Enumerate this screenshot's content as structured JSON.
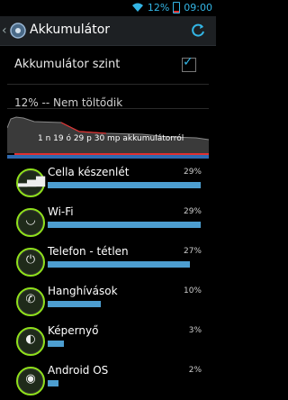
{
  "status_bar": {
    "battery_percent": "12%",
    "time": "09:00"
  },
  "action_bar": {
    "title": "Akkumulátor"
  },
  "settings": {
    "battery_level_label": "Akkumulátor szint",
    "battery_level_checked": true
  },
  "battery_status": "12% -- Nem töltődik",
  "graph": {
    "label": "1 n 19 ó 29 p 30 mp akkumulátorról"
  },
  "usage": [
    {
      "name": "Cella készenlét",
      "percent": "29%",
      "value": 29,
      "icon": "signal-bars-icon"
    },
    {
      "name": "Wi-Fi",
      "percent": "29%",
      "value": 29,
      "icon": "wifi-icon"
    },
    {
      "name": "Telefon - tétlen",
      "percent": "27%",
      "value": 27,
      "icon": "power-icon"
    },
    {
      "name": "Hanghívások",
      "percent": "10%",
      "value": 10,
      "icon": "phone-icon"
    },
    {
      "name": "Képernyő",
      "percent": "3%",
      "value": 3,
      "icon": "brightness-icon"
    },
    {
      "name": "Android OS",
      "percent": "2%",
      "value": 2,
      "icon": "android-icon"
    }
  ],
  "colors": {
    "accent": "#33b5e5",
    "bar": "#4d9ed0",
    "icon_ring": "#8fe01c",
    "low_battery": "#e03030"
  }
}
